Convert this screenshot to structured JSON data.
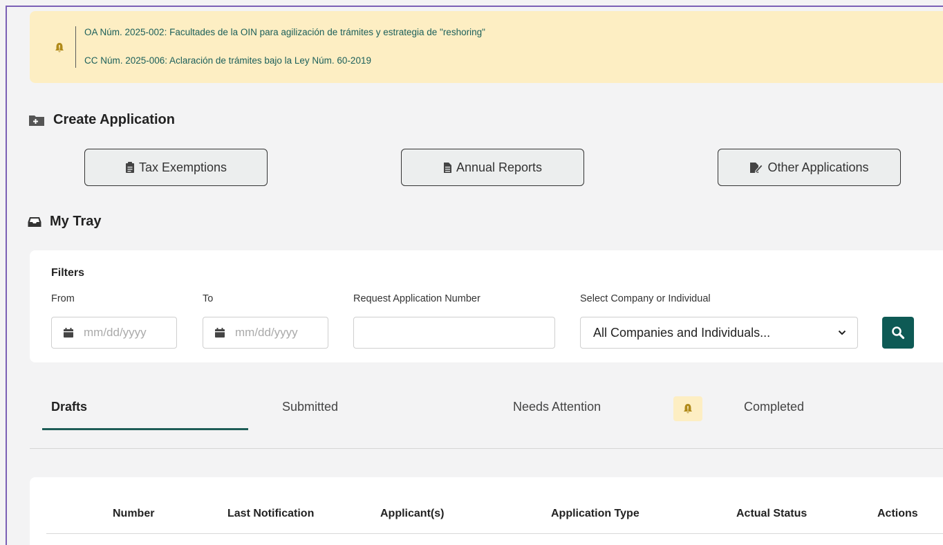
{
  "notice": {
    "items": [
      "OA Núm. 2025-002: Facultades de la OIN para agilización de trámites y estrategia de \"reshoring\"",
      "CC Núm. 2025-006: Aclaración de trámites bajo la Ley Núm. 60-2019"
    ],
    "icon": "bell-icon"
  },
  "create_application": {
    "title": "Create Application",
    "buttons": [
      {
        "label": "Tax Exemptions",
        "icon": "clipboard-icon"
      },
      {
        "label": "Annual Reports",
        "icon": "document-icon"
      },
      {
        "label": "Other Applications",
        "icon": "edit-document-icon"
      }
    ]
  },
  "my_tray": {
    "title": "My Tray"
  },
  "filters": {
    "title": "Filters",
    "from_label": "From",
    "to_label": "To",
    "request_number_label": "Request Application Number",
    "company_label": "Select Company or Individual",
    "date_placeholder": "mm/dd/yyyy",
    "request_number_value": "",
    "company_selected": "All Companies and Individuals..."
  },
  "tabs": [
    {
      "label": "Drafts",
      "active": true
    },
    {
      "label": "Submitted",
      "active": false
    },
    {
      "label": "Needs Attention",
      "active": false
    },
    {
      "label": "Completed",
      "active": false
    }
  ],
  "table": {
    "columns": [
      "Number",
      "Last Notification",
      "Applicant(s)",
      "Application Type",
      "Actual Status",
      "Actions"
    ]
  },
  "colors": {
    "accent": "#0e5a55",
    "notice_bg": "#fdeec3",
    "notice_text": "#1b5f5a",
    "frame": "#7a5fb5"
  }
}
